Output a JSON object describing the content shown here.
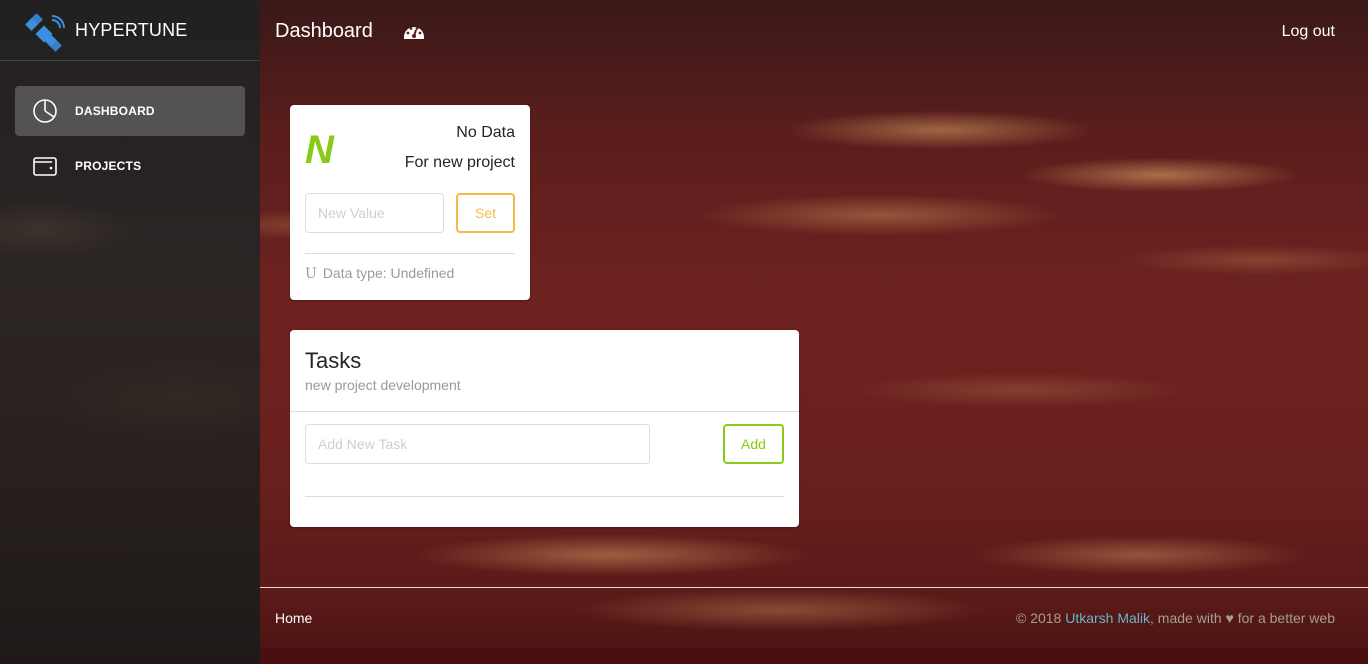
{
  "sidebar": {
    "brand": "HYPERTUNE",
    "items": [
      {
        "label": "DASHBOARD",
        "icon": "pie-chart-icon",
        "active": true
      },
      {
        "label": "PROJECTS",
        "icon": "wallet-icon",
        "active": false
      }
    ]
  },
  "topbar": {
    "title": "Dashboard",
    "title_icon": "dashboard-gauge-icon",
    "logout": "Log out"
  },
  "stat_card": {
    "letter": "N",
    "title": "No Data",
    "subtitle": "For new project",
    "input_placeholder": "New Value",
    "set_label": "Set",
    "footer_icon_glyph": "U",
    "footer_text": "Data type: Undefined"
  },
  "tasks_card": {
    "title": "Tasks",
    "subtitle": "new project development",
    "input_placeholder": "Add New Task",
    "add_label": "Add"
  },
  "footer": {
    "home": "Home",
    "copyright_prefix": "© 2018 ",
    "author": "Utkarsh Malik",
    "made_with": ", made with ",
    "heart": "♥",
    "suffix": " for a better web"
  },
  "colors": {
    "success": "#87cb16",
    "warning": "#f3bb45",
    "info": "#68b3c8"
  }
}
